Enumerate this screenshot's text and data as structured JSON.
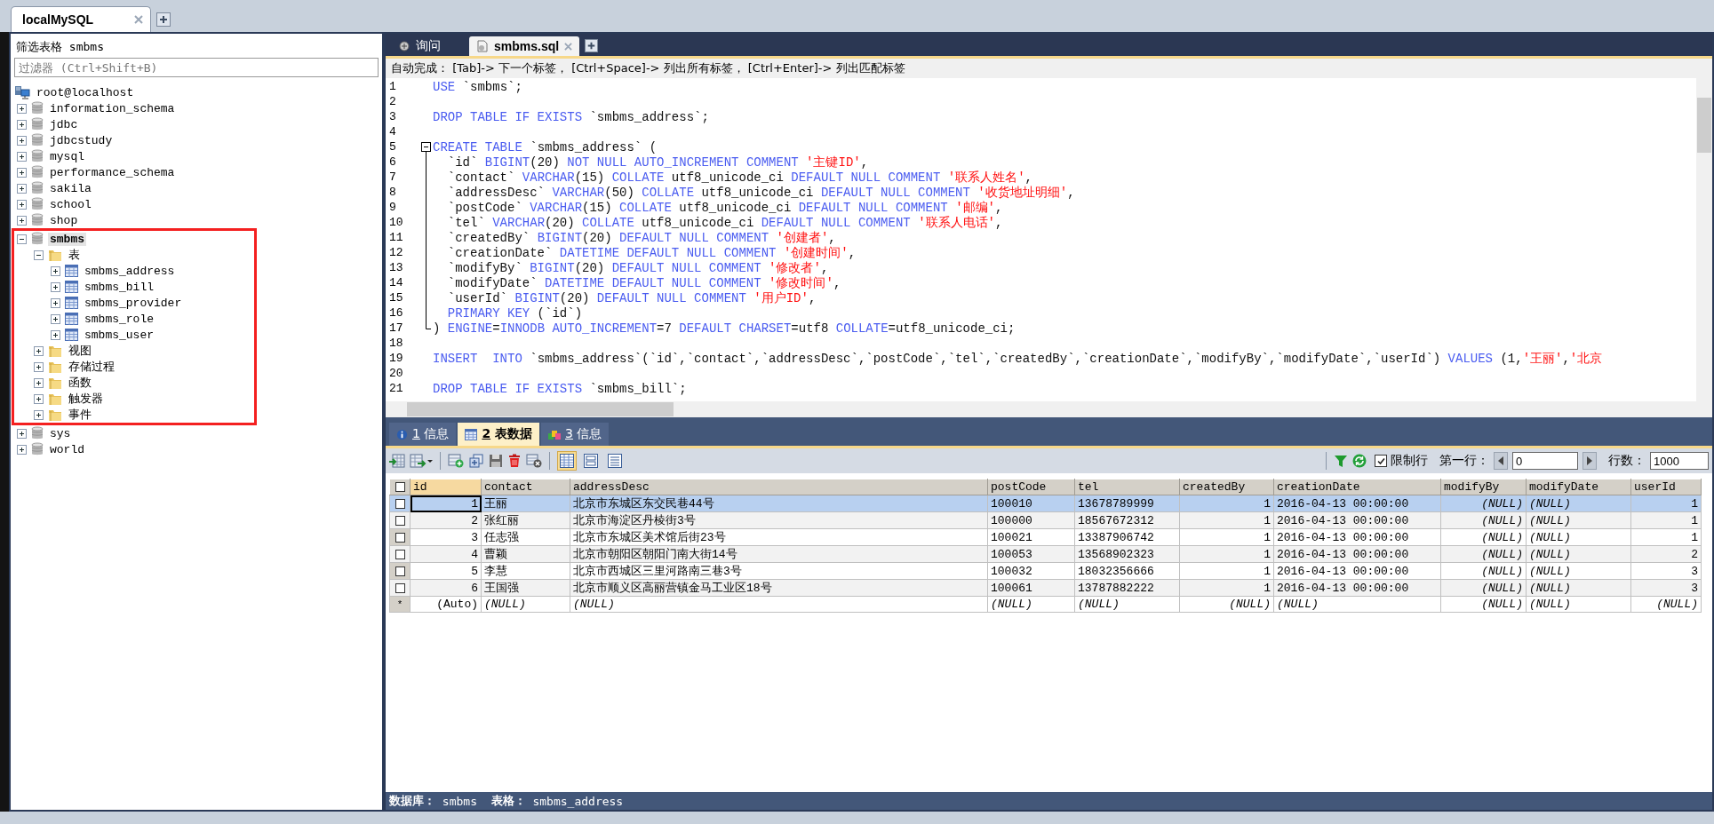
{
  "connection_tabs": [
    {
      "label": "localMySQL",
      "selected": true
    }
  ],
  "object_browser": {
    "filter_label": "筛选表格 smbms",
    "filter_placeholder": "过滤器 (Ctrl+Shift+B)",
    "tree": [
      {
        "label": "root@localhost",
        "kind": "server",
        "selected": false,
        "children": [
          {
            "label": "information_schema",
            "kind": "database",
            "expanded": false,
            "selected": false
          },
          {
            "label": "jdbc",
            "kind": "database",
            "expanded": false,
            "selected": false
          },
          {
            "label": "jdbcstudy",
            "kind": "database",
            "expanded": false,
            "selected": false
          },
          {
            "label": "mysql",
            "kind": "database",
            "expanded": false,
            "selected": false
          },
          {
            "label": "performance_schema",
            "kind": "database",
            "expanded": false,
            "selected": false
          },
          {
            "label": "sakila",
            "kind": "database",
            "expanded": false,
            "selected": false
          },
          {
            "label": "school",
            "kind": "database",
            "expanded": false,
            "selected": false
          },
          {
            "label": "shop",
            "kind": "database",
            "expanded": false,
            "selected": false
          },
          {
            "label": "smbms",
            "kind": "database",
            "expanded": true,
            "selected": true,
            "highlighted": true,
            "children": [
              {
                "label": "表",
                "kind": "folder",
                "expanded": true,
                "selected": false,
                "children": [
                  {
                    "label": "smbms_address",
                    "kind": "table",
                    "expanded": false,
                    "selected": false
                  },
                  {
                    "label": "smbms_bill",
                    "kind": "table",
                    "expanded": false,
                    "selected": false
                  },
                  {
                    "label": "smbms_provider",
                    "kind": "table",
                    "expanded": false,
                    "selected": false
                  },
                  {
                    "label": "smbms_role",
                    "kind": "table",
                    "expanded": false,
                    "selected": false
                  },
                  {
                    "label": "smbms_user",
                    "kind": "table",
                    "expanded": false,
                    "selected": false
                  }
                ]
              },
              {
                "label": "视图",
                "kind": "folder",
                "expanded": false,
                "selected": false
              },
              {
                "label": "存储过程",
                "kind": "folder",
                "expanded": false,
                "selected": false
              },
              {
                "label": "函数",
                "kind": "folder",
                "expanded": false,
                "selected": false
              },
              {
                "label": "触发器",
                "kind": "folder",
                "expanded": false,
                "selected": false
              },
              {
                "label": "事件",
                "kind": "folder",
                "expanded": false,
                "selected": false
              }
            ]
          },
          {
            "label": "sys",
            "kind": "database",
            "expanded": false,
            "selected": false
          },
          {
            "label": "world",
            "kind": "database",
            "expanded": false,
            "selected": false
          }
        ]
      }
    ]
  },
  "editor_tabs": [
    {
      "label": "询问",
      "kind": "query",
      "selected": false
    },
    {
      "label": "smbms.sql",
      "kind": "file",
      "selected": true
    }
  ],
  "hint_bar": "自动完成： [Tab]-> 下一个标签， [Ctrl+Space]-> 列出所有标签， [Ctrl+Enter]-> 列出匹配标签",
  "code_lines": [
    {
      "number": "1",
      "tokens": [
        {
          "kind": "keyword",
          "text": "USE"
        },
        {
          "kind": "plain",
          "text": " `smbms`;"
        }
      ]
    },
    {
      "number": "2"
    },
    {
      "number": "3",
      "tokens": [
        {
          "kind": "keyword",
          "text": "DROP TABLE IF EXISTS"
        },
        {
          "kind": "plain",
          "text": " `smbms_address`;"
        }
      ]
    },
    {
      "number": "4"
    },
    {
      "number": "5",
      "fold_start": true,
      "tokens": [
        {
          "kind": "keyword",
          "text": "CREATE TABLE"
        },
        {
          "kind": "plain",
          "text": " `smbms_address` ("
        }
      ]
    },
    {
      "number": "6",
      "tokens": [
        {
          "kind": "plain",
          "text": "  `id` "
        },
        {
          "kind": "keyword",
          "text": "BIGINT"
        },
        {
          "kind": "plain",
          "text": "(20) "
        },
        {
          "kind": "keyword",
          "text": "NOT NULL AUTO_INCREMENT COMMENT "
        },
        {
          "kind": "string",
          "text": "'主键ID'"
        },
        {
          "kind": "plain",
          "text": ","
        }
      ]
    },
    {
      "number": "7",
      "tokens": [
        {
          "kind": "plain",
          "text": "  `contact` "
        },
        {
          "kind": "keyword",
          "text": "VARCHAR"
        },
        {
          "kind": "plain",
          "text": "(15) "
        },
        {
          "kind": "keyword",
          "text": "COLLATE"
        },
        {
          "kind": "plain",
          "text": " utf8_unicode_ci "
        },
        {
          "kind": "keyword",
          "text": "DEFAULT NULL COMMENT "
        },
        {
          "kind": "string",
          "text": "'联系人姓名'"
        },
        {
          "kind": "plain",
          "text": ","
        }
      ]
    },
    {
      "number": "8",
      "tokens": [
        {
          "kind": "plain",
          "text": "  `addressDesc` "
        },
        {
          "kind": "keyword",
          "text": "VARCHAR"
        },
        {
          "kind": "plain",
          "text": "(50) "
        },
        {
          "kind": "keyword",
          "text": "COLLATE"
        },
        {
          "kind": "plain",
          "text": " utf8_unicode_ci "
        },
        {
          "kind": "keyword",
          "text": "DEFAULT NULL COMMENT "
        },
        {
          "kind": "string",
          "text": "'收货地址明细'"
        },
        {
          "kind": "plain",
          "text": ","
        }
      ]
    },
    {
      "number": "9",
      "tokens": [
        {
          "kind": "plain",
          "text": "  `postCode` "
        },
        {
          "kind": "keyword",
          "text": "VARCHAR"
        },
        {
          "kind": "plain",
          "text": "(15) "
        },
        {
          "kind": "keyword",
          "text": "COLLATE"
        },
        {
          "kind": "plain",
          "text": " utf8_unicode_ci "
        },
        {
          "kind": "keyword",
          "text": "DEFAULT NULL COMMENT "
        },
        {
          "kind": "string",
          "text": "'邮编'"
        },
        {
          "kind": "plain",
          "text": ","
        }
      ]
    },
    {
      "number": "10",
      "tokens": [
        {
          "kind": "plain",
          "text": "  `tel` "
        },
        {
          "kind": "keyword",
          "text": "VARCHAR"
        },
        {
          "kind": "plain",
          "text": "(20) "
        },
        {
          "kind": "keyword",
          "text": "COLLATE"
        },
        {
          "kind": "plain",
          "text": " utf8_unicode_ci "
        },
        {
          "kind": "keyword",
          "text": "DEFAULT NULL COMMENT "
        },
        {
          "kind": "string",
          "text": "'联系人电话'"
        },
        {
          "kind": "plain",
          "text": ","
        }
      ]
    },
    {
      "number": "11",
      "tokens": [
        {
          "kind": "plain",
          "text": "  `createdBy` "
        },
        {
          "kind": "keyword",
          "text": "BIGINT"
        },
        {
          "kind": "plain",
          "text": "(20) "
        },
        {
          "kind": "keyword",
          "text": "DEFAULT NULL COMMENT "
        },
        {
          "kind": "string",
          "text": "'创建者'"
        },
        {
          "kind": "plain",
          "text": ","
        }
      ]
    },
    {
      "number": "12",
      "tokens": [
        {
          "kind": "plain",
          "text": "  `creationDate` "
        },
        {
          "kind": "keyword",
          "text": "DATETIME DEFAULT NULL COMMENT "
        },
        {
          "kind": "string",
          "text": "'创建时间'"
        },
        {
          "kind": "plain",
          "text": ","
        }
      ]
    },
    {
      "number": "13",
      "tokens": [
        {
          "kind": "plain",
          "text": "  `modifyBy` "
        },
        {
          "kind": "keyword",
          "text": "BIGINT"
        },
        {
          "kind": "plain",
          "text": "(20) "
        },
        {
          "kind": "keyword",
          "text": "DEFAULT NULL COMMENT "
        },
        {
          "kind": "string",
          "text": "'修改者'"
        },
        {
          "kind": "plain",
          "text": ","
        }
      ]
    },
    {
      "number": "14",
      "tokens": [
        {
          "kind": "plain",
          "text": "  `modifyDate` "
        },
        {
          "kind": "keyword",
          "text": "DATETIME DEFAULT NULL COMMENT "
        },
        {
          "kind": "string",
          "text": "'修改时间'"
        },
        {
          "kind": "plain",
          "text": ","
        }
      ]
    },
    {
      "number": "15",
      "tokens": [
        {
          "kind": "plain",
          "text": "  `userId` "
        },
        {
          "kind": "keyword",
          "text": "BIGINT"
        },
        {
          "kind": "plain",
          "text": "(20) "
        },
        {
          "kind": "keyword",
          "text": "DEFAULT NULL COMMENT "
        },
        {
          "kind": "string",
          "text": "'用户ID'"
        },
        {
          "kind": "plain",
          "text": ","
        }
      ]
    },
    {
      "number": "16",
      "tokens": [
        {
          "kind": "keyword",
          "text": "  PRIMARY KEY"
        },
        {
          "kind": "plain",
          "text": " (`id`)"
        }
      ]
    },
    {
      "number": "17",
      "fold_end": true,
      "tokens": [
        {
          "kind": "plain",
          "text": ") "
        },
        {
          "kind": "keyword",
          "text": "ENGINE"
        },
        {
          "kind": "plain",
          "text": "="
        },
        {
          "kind": "keyword",
          "text": "INNODB AUTO_INCREMENT"
        },
        {
          "kind": "plain",
          "text": "=7 "
        },
        {
          "kind": "keyword",
          "text": "DEFAULT CHARSET"
        },
        {
          "kind": "plain",
          "text": "=utf8 "
        },
        {
          "kind": "keyword",
          "text": "COLLATE"
        },
        {
          "kind": "plain",
          "text": "=utf8_unicode_ci;"
        }
      ]
    },
    {
      "number": "18"
    },
    {
      "number": "19",
      "tokens": [
        {
          "kind": "keyword",
          "text": "INSERT  INTO"
        },
        {
          "kind": "plain",
          "text": " `smbms_address`(`id`,`contact`,`addressDesc`,`postCode`,`tel`,`createdBy`,`creationDate`,`modifyBy`,`modifyDate`,`userId`) "
        },
        {
          "kind": "keyword",
          "text": "VALUES"
        },
        {
          "kind": "plain",
          "text": " (1,"
        },
        {
          "kind": "string",
          "text": "'王丽'"
        },
        {
          "kind": "plain",
          "text": ","
        },
        {
          "kind": "string",
          "text": "'北京"
        }
      ]
    },
    {
      "number": "20"
    },
    {
      "number": "21",
      "tokens": [
        {
          "kind": "keyword",
          "text": "DROP TABLE IF EXISTS"
        },
        {
          "kind": "plain",
          "text": " `smbms_bill`;"
        }
      ]
    }
  ],
  "result_tabs": [
    {
      "number": "1",
      "label": "信息",
      "kind": "info",
      "selected": false
    },
    {
      "number": "2",
      "label": "表数据",
      "kind": "table",
      "selected": true
    },
    {
      "number": "3",
      "label": "信息",
      "kind": "profile",
      "selected": false
    }
  ],
  "result_toolbar": {
    "limit_rows": {
      "label": "限制行",
      "checked": true
    },
    "first_row": {
      "label": "第一行：",
      "value": "0"
    },
    "row_count": {
      "label": "行数：",
      "value": "1000"
    }
  },
  "table": {
    "all_checked": false,
    "columns": [
      {
        "name": "id",
        "numeric": true,
        "selected": true
      },
      {
        "name": "contact",
        "numeric": false,
        "selected": false
      },
      {
        "name": "addressDesc",
        "numeric": false,
        "selected": false
      },
      {
        "name": "postCode",
        "numeric": false,
        "selected": false
      },
      {
        "name": "tel",
        "numeric": false,
        "selected": false
      },
      {
        "name": "createdBy",
        "numeric": true,
        "selected": false
      },
      {
        "name": "creationDate",
        "numeric": false,
        "selected": false
      },
      {
        "name": "modifyBy",
        "numeric": true,
        "selected": false
      },
      {
        "name": "modifyDate",
        "numeric": false,
        "selected": false
      },
      {
        "name": "userId",
        "numeric": true,
        "selected": false
      }
    ],
    "rows": [
      {
        "kind": "data",
        "selected": true,
        "checked": false,
        "cells": [
          "1",
          "王丽",
          "北京市东城区东交民巷44号",
          "100010",
          "13678789999",
          "1",
          "2016-04-13 00:00:00",
          {
            "text": "(NULL)",
            "null": true
          },
          {
            "text": "(NULL)",
            "null": true
          },
          "1"
        ]
      },
      {
        "kind": "data",
        "selected": false,
        "checked": false,
        "cells": [
          "2",
          "张红丽",
          "北京市海淀区丹棱街3号",
          "100000",
          "18567672312",
          "1",
          "2016-04-13 00:00:00",
          {
            "text": "(NULL)",
            "null": true
          },
          {
            "text": "(NULL)",
            "null": true
          },
          "1"
        ]
      },
      {
        "kind": "data",
        "selected": false,
        "checked": false,
        "cells": [
          "3",
          "任志强",
          "北京市东城区美术馆后街23号",
          "100021",
          "13387906742",
          "1",
          "2016-04-13 00:00:00",
          {
            "text": "(NULL)",
            "null": true
          },
          {
            "text": "(NULL)",
            "null": true
          },
          "1"
        ]
      },
      {
        "kind": "data",
        "selected": false,
        "checked": false,
        "cells": [
          "4",
          "曹颖",
          "北京市朝阳区朝阳门南大街14号",
          "100053",
          "13568902323",
          "1",
          "2016-04-13 00:00:00",
          {
            "text": "(NULL)",
            "null": true
          },
          {
            "text": "(NULL)",
            "null": true
          },
          "2"
        ]
      },
      {
        "kind": "data",
        "selected": false,
        "checked": false,
        "cells": [
          "5",
          "李慧",
          "北京市西城区三里河路南三巷3号",
          "100032",
          "18032356666",
          "1",
          "2016-04-13 00:00:00",
          {
            "text": "(NULL)",
            "null": true
          },
          {
            "text": "(NULL)",
            "null": true
          },
          "3"
        ]
      },
      {
        "kind": "data",
        "selected": false,
        "checked": false,
        "cells": [
          "6",
          "王国强",
          "北京市顺义区高丽营镇金马工业区18号",
          "100061",
          "13787882222",
          "1",
          "2016-04-13 00:00:00",
          {
            "text": "(NULL)",
            "null": true
          },
          {
            "text": "(NULL)",
            "null": true
          },
          "3"
        ]
      },
      {
        "kind": "new",
        "marker": "*",
        "selected": false,
        "cells": [
          "(Auto)",
          {
            "text": "(NULL)",
            "null": true
          },
          {
            "text": "(NULL)",
            "null": true
          },
          {
            "text": "(NULL)",
            "null": true
          },
          {
            "text": "(NULL)",
            "null": true
          },
          {
            "text": "(NULL)",
            "null": true
          },
          {
            "text": "(NULL)",
            "null": true
          },
          {
            "text": "(NULL)",
            "null": true
          },
          {
            "text": "(NULL)",
            "null": true
          },
          {
            "text": "(NULL)",
            "null": true
          }
        ]
      }
    ]
  },
  "status_bar": "**数据库：** smbms  **表格：** smbms_address"
}
